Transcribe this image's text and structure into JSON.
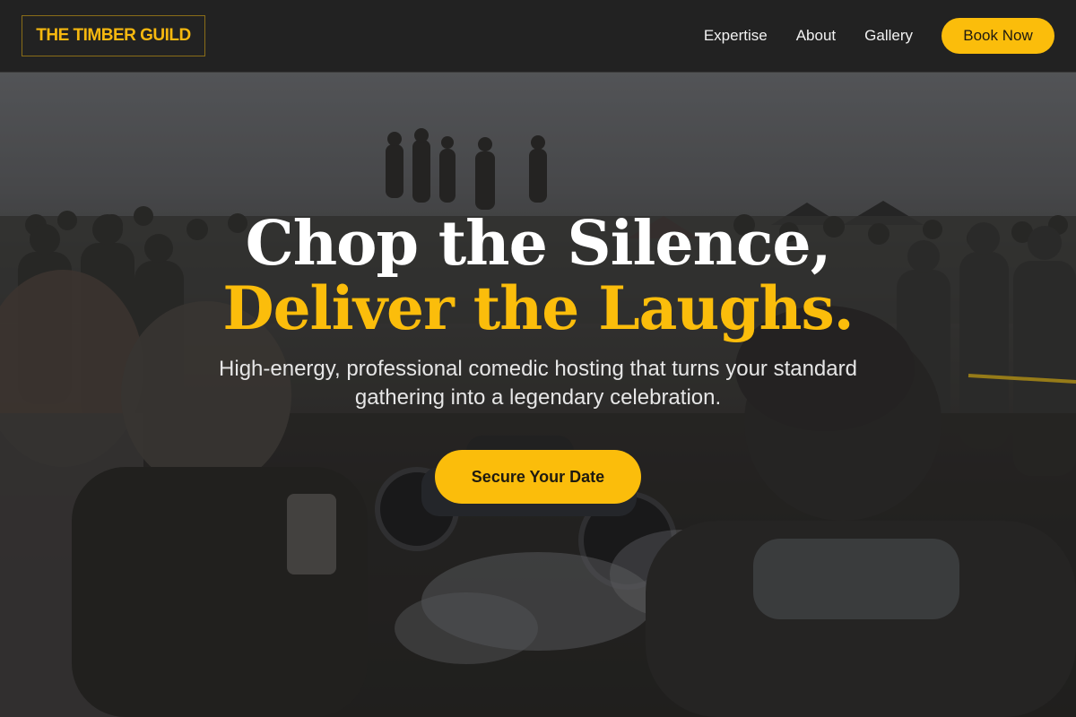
{
  "header": {
    "logo_text": "THE TIMBER GUILD",
    "nav": [
      {
        "label": "Expertise"
      },
      {
        "label": "About"
      },
      {
        "label": "Gallery"
      }
    ],
    "book_label": "Book Now"
  },
  "hero": {
    "headline_line1": "Chop the Silence,",
    "headline_line2": "Deliver the Laughs.",
    "subtitle": "High-energy, professional comedic hosting that turns your standard gathering into a legendary celebration.",
    "cta_label": "Secure Your Date"
  },
  "colors": {
    "accent": "#fbbd0b",
    "header_bg": "#222222",
    "headline_white": "#ffffff"
  }
}
